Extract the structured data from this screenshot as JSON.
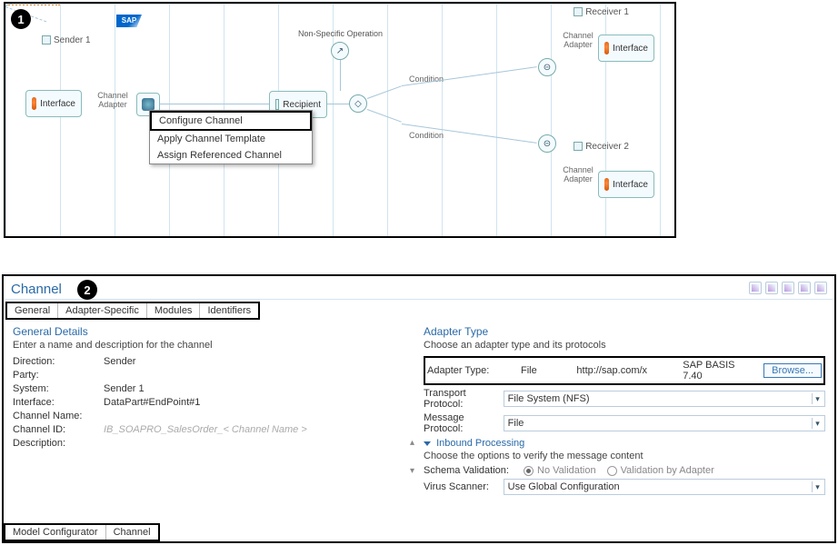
{
  "callouts": {
    "one": "1",
    "two": "2"
  },
  "diagram": {
    "logo": "SAP",
    "swimlanes": {
      "sender": "Sender 1",
      "recv1": "Receiver 1",
      "recv2": "Receiver 2"
    },
    "nodes": {
      "sender_interface": "Interface",
      "recipient": "Recipient",
      "recv1_interface": "Interface",
      "recv2_interface": "Interface"
    },
    "edge_labels": {
      "channel_adapter_left": "Channel Adapter",
      "channel_adapter_right1": "Channel Adapter",
      "channel_adapter_right2": "Channel Adapter",
      "non_specific_op": "Non-Specific Operation",
      "condition1": "Condition",
      "condition2": "Condition"
    },
    "context_menu": {
      "configure": "Configure Channel",
      "apply": "Apply Channel Template",
      "assign": "Assign Referenced Channel"
    }
  },
  "channel": {
    "title": "Channel",
    "tabs": {
      "general": "General",
      "adapter": "Adapter-Specific",
      "modules": "Modules",
      "identifiers": "Identifiers"
    },
    "general": {
      "section_title": "General Details",
      "section_sub": "Enter a name and description for the channel",
      "direction_label": "Direction:",
      "direction_value": "Sender",
      "party_label": "Party:",
      "party_value": "",
      "system_label": "System:",
      "system_value": "Sender  1",
      "interface_label": "Interface:",
      "interface_value": "DataPart#EndPoint#1",
      "channel_name_label": "Channel Name:",
      "channel_name_value": "",
      "channel_id_label": "Channel ID:",
      "channel_id_value": "IB_SOAPRO_SalesOrder_< Channel Name >",
      "description_label": "Description:",
      "description_value": ""
    },
    "adapter": {
      "section_title": "Adapter Type",
      "section_sub": "Choose an adapter type and its protocols",
      "type_label": "Adapter Type:",
      "type_value": "File",
      "type_ns": "http://sap.com/x",
      "type_basis": "SAP BASIS 7.40",
      "browse": "Browse...",
      "transport_label": "Transport Protocol:",
      "transport_value": "File System (NFS)",
      "message_label": "Message Protocol:",
      "message_value": "File",
      "inbound_title": "Inbound Processing",
      "inbound_sub": "Choose the options to verify the message content",
      "schema_label": "Schema Validation:",
      "schema_opt1": "No Validation",
      "schema_opt2": "Validation by Adapter",
      "virus_label": "Virus Scanner:",
      "virus_value": "Use Global Configuration"
    },
    "bottom_tabs": {
      "model": "Model Configurator",
      "channel": "Channel"
    }
  }
}
